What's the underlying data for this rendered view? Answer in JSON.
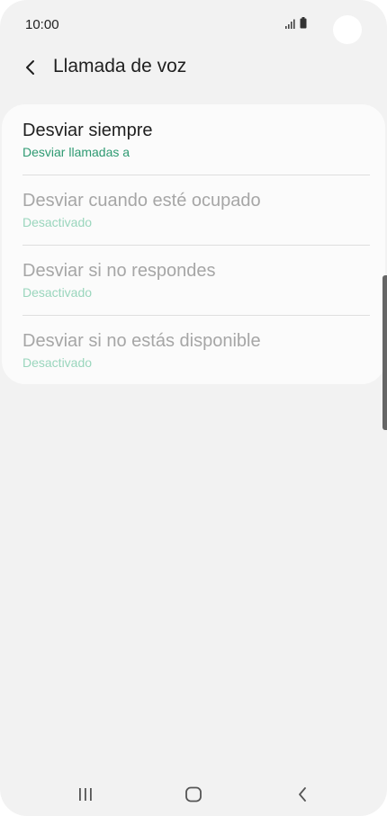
{
  "status_bar": {
    "time": "10:00",
    "icons": [
      "signal-icon",
      "battery-icon"
    ]
  },
  "header": {
    "back_icon": "back-arrow-icon",
    "title": "Llamada de voz"
  },
  "settings": {
    "items": [
      {
        "title": "Desviar siempre",
        "subtitle": "Desviar llamadas a",
        "enabled": true
      },
      {
        "title": "Desviar cuando esté ocupado",
        "subtitle": "Desactivado",
        "enabled": false
      },
      {
        "title": "Desviar si no respondes",
        "subtitle": "Desactivado",
        "enabled": false
      },
      {
        "title": "Desviar si no estás disponible",
        "subtitle": "Desactivado",
        "enabled": false
      }
    ]
  },
  "navigation_bar": {
    "icons": [
      "recents-icon",
      "home-icon",
      "back-icon"
    ]
  },
  "colors": {
    "background": "#f2f2f2",
    "card": "#fbfbfb",
    "accent_green": "#2e9a72",
    "disabled_green": "#9ad6bd",
    "disabled_text": "#a6a6a6"
  }
}
